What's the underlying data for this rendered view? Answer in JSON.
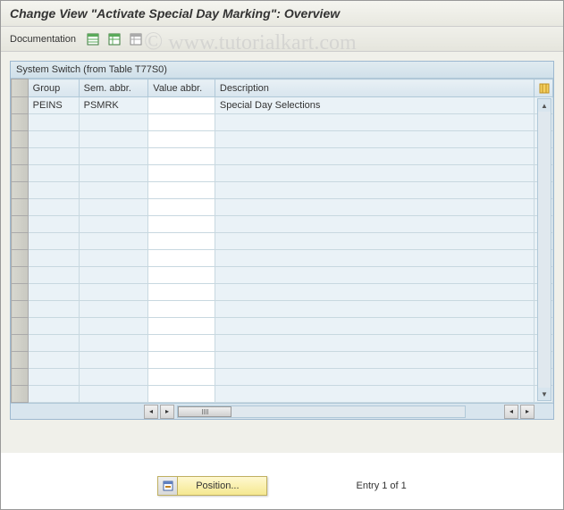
{
  "title": "Change View \"Activate Special Day Marking\": Overview",
  "toolbar": {
    "documentation_label": "Documentation"
  },
  "table": {
    "caption": "System Switch (from Table T77S0)",
    "columns": {
      "group": "Group",
      "sem_abbr": "Sem. abbr.",
      "value_abbr": "Value abbr.",
      "description": "Description"
    },
    "rows": [
      {
        "group": "PEINS",
        "sem": "PSMRK",
        "value": "",
        "desc": "Special Day Selections"
      }
    ]
  },
  "footer": {
    "position_label": "Position...",
    "entry_text": "Entry 1 of 1"
  },
  "watermark": "www.tutorialkart.com"
}
